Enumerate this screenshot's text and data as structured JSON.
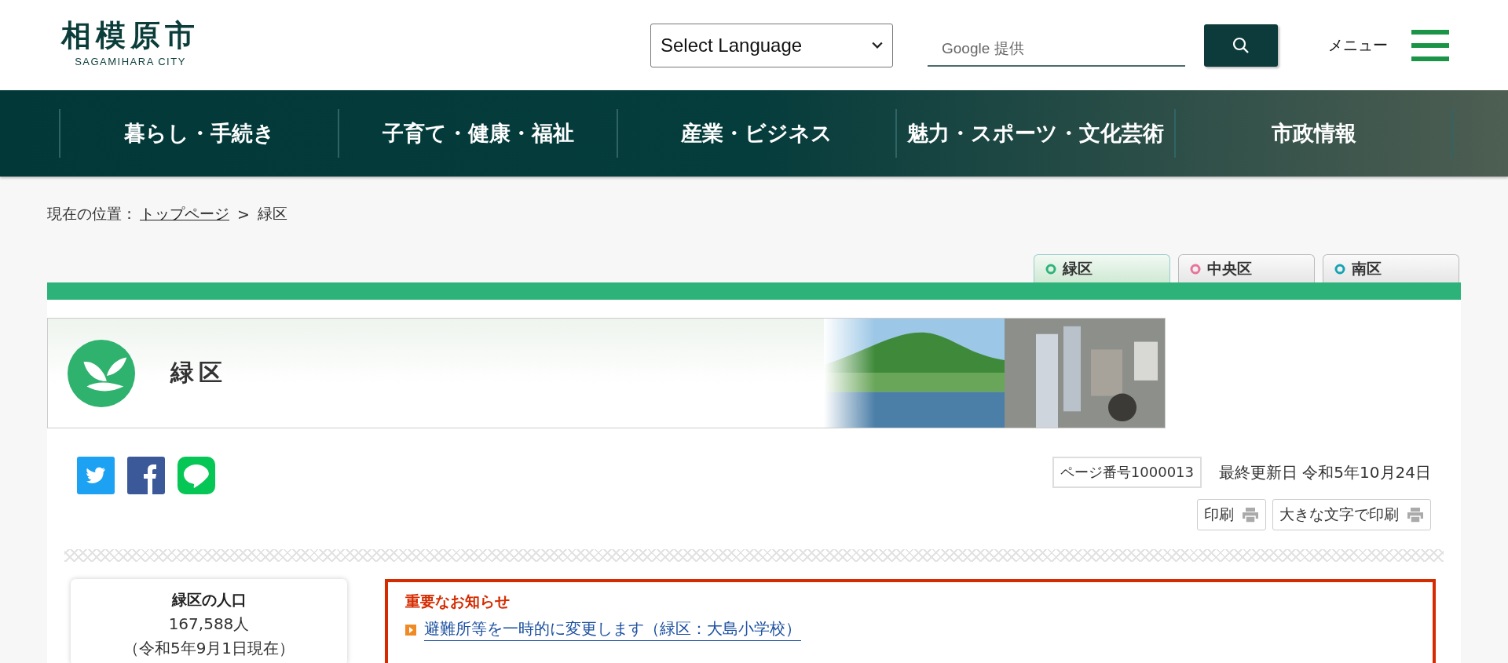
{
  "header": {
    "logo_title": "相模原市",
    "logo_subtitle": "SAGAMIHARA CITY",
    "language_select": {
      "value": "Select Language"
    },
    "search": {
      "placeholder": "Google 提供"
    },
    "menu_label": "メニュー"
  },
  "nav": [
    {
      "label": "暮らし・手続き"
    },
    {
      "label": "子育て・健康・福祉"
    },
    {
      "label": "産業・ビジネス"
    },
    {
      "label": "魅力・スポーツ・文化芸術"
    },
    {
      "label": "市政情報"
    }
  ],
  "breadcrumb": {
    "label": "現在の位置：",
    "link": "トップページ",
    "separator": ">",
    "current": "緑区"
  },
  "ward_tabs": [
    {
      "label": "緑区",
      "selected": true,
      "color": "#2db37a"
    },
    {
      "label": "中央区",
      "selected": false,
      "color": "#e8739a"
    },
    {
      "label": "南区",
      "selected": false,
      "color": "#14a3b5"
    }
  ],
  "banner": {
    "title": "緑区"
  },
  "page_info": {
    "page_number": "ページ番号1000013",
    "updated": "最終更新日 令和5年10月24日"
  },
  "print_buttons": [
    {
      "label": "印刷"
    },
    {
      "label": "大きな文字で印刷"
    }
  ],
  "population": {
    "title": "緑区の人口",
    "value": "167,588人",
    "note": "（令和5年9月1日現在）"
  },
  "notice": {
    "title": "重要なお知らせ",
    "items": [
      {
        "text": "避難所等を一時的に変更します（緑区：大島小学校）"
      }
    ]
  }
}
